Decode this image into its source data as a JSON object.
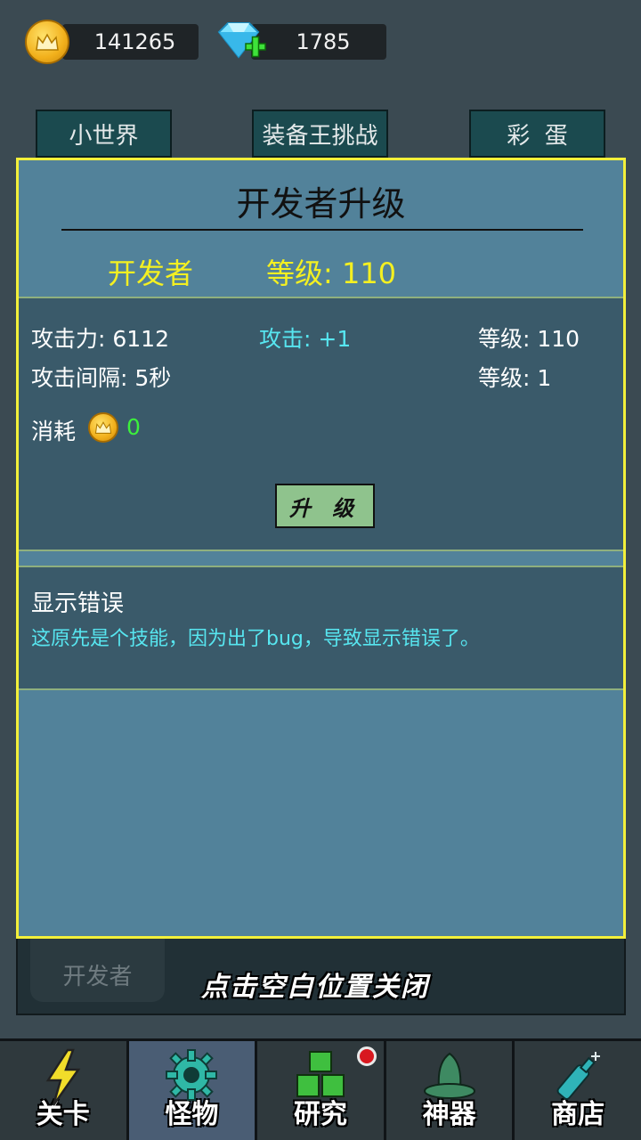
{
  "currency": {
    "gold": "141265",
    "diamonds": "1785"
  },
  "top_tabs": [
    "小世界",
    "装备王挑战",
    "彩  蛋"
  ],
  "background": {
    "hero_name": "开发者",
    "close_hint": "点击空白位置关闭"
  },
  "dialog": {
    "title": "开发者升级",
    "name": "开发者",
    "level_label": "等级: 110",
    "attack_power": "攻击力: 6112",
    "attack_bonus": "攻击: +1",
    "attack_level": "等级: 110",
    "attack_interval": "攻击间隔: 5秒",
    "interval_level": "等级: 1",
    "cost_label": "消耗",
    "cost_value": "0",
    "upgrade_button": "升 级",
    "skill_title": "显示错误",
    "skill_desc": "这原先是个技能，因为出了bug，导致显示错误了。"
  },
  "nav": [
    {
      "label": "关卡",
      "icon": "lightning-icon"
    },
    {
      "label": "怪物",
      "icon": "gear-icon"
    },
    {
      "label": "研究",
      "icon": "blocks-icon"
    },
    {
      "label": "神器",
      "icon": "hat-icon"
    },
    {
      "label": "商店",
      "icon": "bottle-icon"
    }
  ],
  "colors": {
    "dialog_border": "#f3f03a",
    "dialog_bg": "#52829a",
    "highlight_yellow": "#f4f021",
    "cyan": "#57e6f0",
    "green": "#3cf03c"
  }
}
